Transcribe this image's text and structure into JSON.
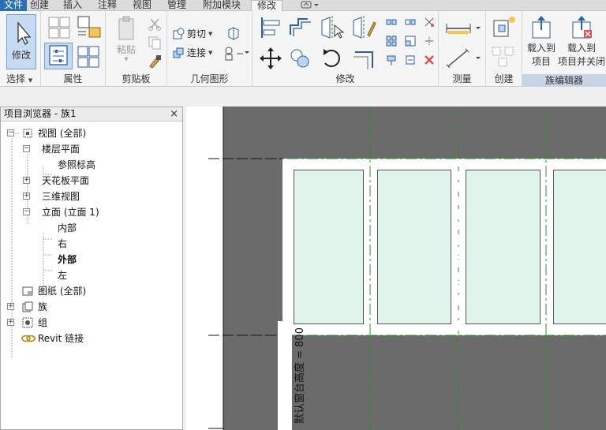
{
  "tabs": [
    "文件",
    "创建",
    "插入",
    "注释",
    "视图",
    "管理",
    "附加模块",
    "修改"
  ],
  "ribbon": {
    "modify_button": "修改",
    "select_label": "选择",
    "properties_label": "属性",
    "paste_label": "粘贴",
    "clipboard_label": "剪贴板",
    "cut_label": "剪切",
    "join_label": "连接",
    "geometry_label": "几何图形",
    "modify_label": "修改",
    "measure_label": "测量",
    "create_label": "创建",
    "load_to_project_label": "载入到 项目",
    "load_to_project_line1": "载入到",
    "load_to_project_line2": "项目",
    "load_close_line1": "载入到",
    "load_close_line2": "项目并关闭",
    "family_editor_label": "族编辑器"
  },
  "browser": {
    "title": "项目浏览器 - 族1",
    "close": "×",
    "items": [
      {
        "label": "视图 (全部)",
        "level": 0,
        "toggle": "−"
      },
      {
        "label": "楼层平面",
        "level": 1,
        "toggle": "−"
      },
      {
        "label": "参照标高",
        "level": 2,
        "toggle": ""
      },
      {
        "label": "天花板平面",
        "level": 1,
        "toggle": "+"
      },
      {
        "label": "三维视图",
        "level": 1,
        "toggle": "+"
      },
      {
        "label": "立面 (立面 1)",
        "level": 1,
        "toggle": "−"
      },
      {
        "label": "内部",
        "level": 2,
        "toggle": ""
      },
      {
        "label": "右",
        "level": 2,
        "toggle": ""
      },
      {
        "label": "外部",
        "level": 2,
        "toggle": "",
        "bold": true
      },
      {
        "label": "左",
        "level": 2,
        "toggle": ""
      },
      {
        "label": "图纸 (全部)",
        "level": 0,
        "toggle": ""
      },
      {
        "label": "族",
        "level": 0,
        "toggle": "+"
      },
      {
        "label": "组",
        "level": 0,
        "toggle": "+"
      },
      {
        "label": "Revit 链接",
        "level": 0,
        "toggle": ""
      }
    ]
  },
  "canvas": {
    "dimension_text": "默认窗台高度 = 800"
  },
  "colors": {
    "file_tab": "#2a6fb7",
    "pane_fill": "#e1f4ec",
    "view_background": "#6b6b6b",
    "reference_line": "#2e8b2e"
  }
}
